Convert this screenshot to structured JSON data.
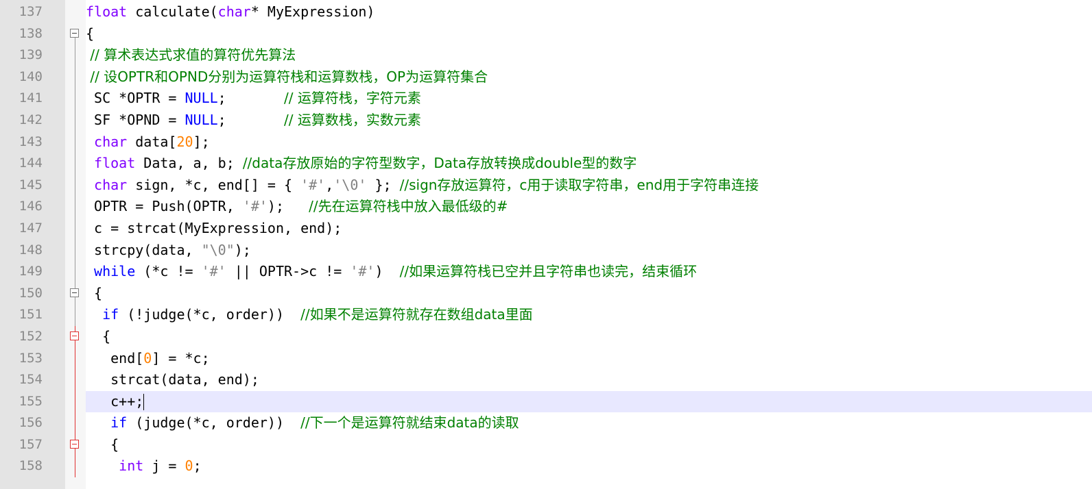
{
  "editor": {
    "lines": [
      {
        "num": "137",
        "fold": "none",
        "current": false,
        "tokens": [
          {
            "t": "float",
            "c": "type"
          },
          {
            "t": " calculate(",
            "c": "plain"
          },
          {
            "t": "char",
            "c": "type"
          },
          {
            "t": "* MyExpression)",
            "c": "plain"
          }
        ]
      },
      {
        "num": "138",
        "fold": "box",
        "current": false,
        "tokens": [
          {
            "t": "{",
            "c": "plain"
          }
        ]
      },
      {
        "num": "139",
        "fold": "line",
        "current": false,
        "tokens": [
          {
            "t": " // 算术表达式求值的算符优先算法",
            "c": "cmt"
          }
        ]
      },
      {
        "num": "140",
        "fold": "line",
        "current": false,
        "tokens": [
          {
            "t": " // 设OPTR和OPND分别为运算符栈和运算数栈，OP为运算符集合",
            "c": "cmt"
          }
        ]
      },
      {
        "num": "141",
        "fold": "line",
        "current": false,
        "tokens": [
          {
            "t": " SC *OPTR = ",
            "c": "plain"
          },
          {
            "t": "NULL",
            "c": "kwblue"
          },
          {
            "t": ";       ",
            "c": "plain"
          },
          {
            "t": "// 运算符栈，字符元素",
            "c": "cmt"
          }
        ]
      },
      {
        "num": "142",
        "fold": "line",
        "current": false,
        "tokens": [
          {
            "t": " SF *OPND = ",
            "c": "plain"
          },
          {
            "t": "NULL",
            "c": "kwblue"
          },
          {
            "t": ";       ",
            "c": "plain"
          },
          {
            "t": "// 运算数栈，实数元素",
            "c": "cmt"
          }
        ]
      },
      {
        "num": "143",
        "fold": "line",
        "current": false,
        "tokens": [
          {
            "t": " ",
            "c": "plain"
          },
          {
            "t": "char",
            "c": "type"
          },
          {
            "t": " data[",
            "c": "plain"
          },
          {
            "t": "20",
            "c": "num"
          },
          {
            "t": "];",
            "c": "plain"
          }
        ]
      },
      {
        "num": "144",
        "fold": "line",
        "current": false,
        "tokens": [
          {
            "t": " ",
            "c": "plain"
          },
          {
            "t": "float",
            "c": "type"
          },
          {
            "t": " Data, a, b; ",
            "c": "plain"
          },
          {
            "t": "//data存放原始的字符型数字，Data存放转换成double型的数字",
            "c": "cmt"
          }
        ]
      },
      {
        "num": "145",
        "fold": "line",
        "current": false,
        "tokens": [
          {
            "t": " ",
            "c": "plain"
          },
          {
            "t": "char",
            "c": "type"
          },
          {
            "t": " sign, *c, end[] = { ",
            "c": "plain"
          },
          {
            "t": "'#'",
            "c": "str"
          },
          {
            "t": ",",
            "c": "plain"
          },
          {
            "t": "'\\0'",
            "c": "str"
          },
          {
            "t": " }; ",
            "c": "plain"
          },
          {
            "t": "//sign存放运算符，c用于读取字符串，end用于字符串连接",
            "c": "cmt"
          }
        ]
      },
      {
        "num": "146",
        "fold": "line",
        "current": false,
        "tokens": [
          {
            "t": " OPTR = Push(OPTR, ",
            "c": "plain"
          },
          {
            "t": "'#'",
            "c": "str"
          },
          {
            "t": ");   ",
            "c": "plain"
          },
          {
            "t": "//先在运算符栈中放入最低级的#",
            "c": "cmt"
          }
        ]
      },
      {
        "num": "147",
        "fold": "line",
        "current": false,
        "tokens": [
          {
            "t": " c = strcat(MyExpression, end);",
            "c": "plain"
          }
        ]
      },
      {
        "num": "148",
        "fold": "line",
        "current": false,
        "tokens": [
          {
            "t": " strcpy(data, ",
            "c": "plain"
          },
          {
            "t": "\"\\0\"",
            "c": "str"
          },
          {
            "t": ");",
            "c": "plain"
          }
        ]
      },
      {
        "num": "149",
        "fold": "line",
        "current": false,
        "tokens": [
          {
            "t": " ",
            "c": "plain"
          },
          {
            "t": "while",
            "c": "kwblue"
          },
          {
            "t": " (*c != ",
            "c": "plain"
          },
          {
            "t": "'#'",
            "c": "str"
          },
          {
            "t": " || OPTR->c != ",
            "c": "plain"
          },
          {
            "t": "'#'",
            "c": "str"
          },
          {
            "t": ")  ",
            "c": "plain"
          },
          {
            "t": "//如果运算符栈已空并且字符串也读完，结束循环",
            "c": "cmt"
          }
        ]
      },
      {
        "num": "150",
        "fold": "box",
        "current": false,
        "tokens": [
          {
            "t": " {",
            "c": "plain"
          }
        ]
      },
      {
        "num": "151",
        "fold": "line",
        "current": false,
        "tokens": [
          {
            "t": "  ",
            "c": "plain"
          },
          {
            "t": "if",
            "c": "kwblue"
          },
          {
            "t": " (!judge(*c, order))  ",
            "c": "plain"
          },
          {
            "t": "//如果不是运算符就存在数组data里面",
            "c": "cmt"
          }
        ]
      },
      {
        "num": "152",
        "fold": "boxred",
        "current": false,
        "tokens": [
          {
            "t": "  {",
            "c": "plain"
          }
        ]
      },
      {
        "num": "153",
        "fold": "linered",
        "current": false,
        "tokens": [
          {
            "t": "   end[",
            "c": "plain"
          },
          {
            "t": "0",
            "c": "num"
          },
          {
            "t": "] = *c;",
            "c": "plain"
          }
        ]
      },
      {
        "num": "154",
        "fold": "linered",
        "current": false,
        "tokens": [
          {
            "t": "   strcat(data, end);",
            "c": "plain"
          }
        ]
      },
      {
        "num": "155",
        "fold": "linered",
        "current": true,
        "tokens": [
          {
            "t": "   c++;",
            "c": "plain"
          }
        ]
      },
      {
        "num": "156",
        "fold": "linered",
        "current": false,
        "tokens": [
          {
            "t": "   ",
            "c": "plain"
          },
          {
            "t": "if",
            "c": "kwblue"
          },
          {
            "t": " (judge(*c, order))  ",
            "c": "plain"
          },
          {
            "t": "//下一个是运算符就结束data的读取",
            "c": "cmt"
          }
        ]
      },
      {
        "num": "157",
        "fold": "boxred",
        "current": false,
        "tokens": [
          {
            "t": "   {",
            "c": "plain"
          }
        ]
      },
      {
        "num": "158",
        "fold": "linered",
        "current": false,
        "tokens": [
          {
            "t": "    ",
            "c": "plain"
          },
          {
            "t": "int",
            "c": "type"
          },
          {
            "t": " j = ",
            "c": "plain"
          },
          {
            "t": "0",
            "c": "num"
          },
          {
            "t": ";",
            "c": "plain"
          }
        ]
      }
    ]
  }
}
